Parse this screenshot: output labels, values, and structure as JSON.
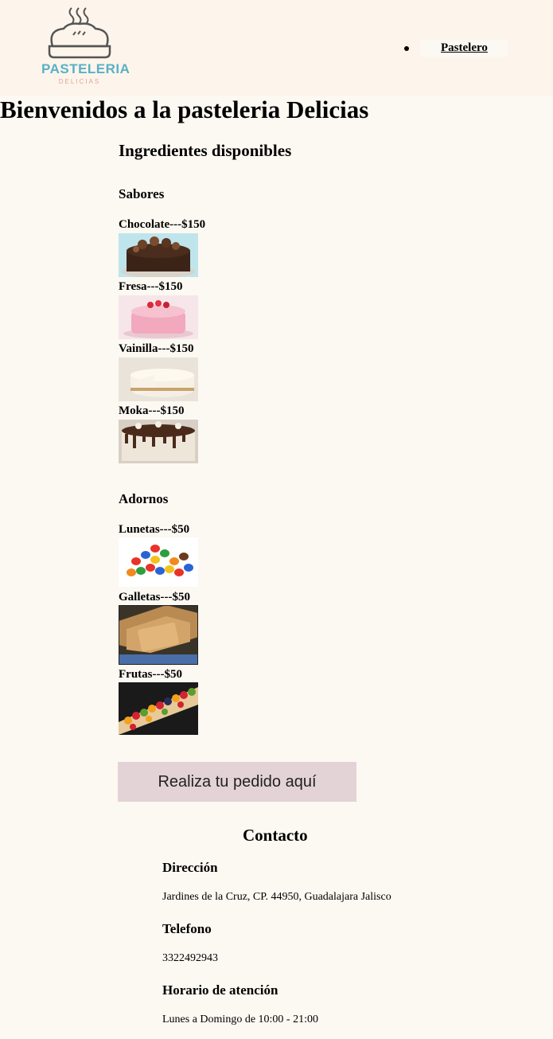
{
  "header": {
    "logo": {
      "name": "PASTELERIA",
      "sub": "DELICIAS"
    },
    "nav": [
      {
        "label": "Pastelero"
      }
    ]
  },
  "page_title": "Bienvenidos a la pasteleria Delicias",
  "ingredients": {
    "title": "Ingredientes disponibles",
    "sabores_title": "Sabores",
    "sabores": [
      {
        "label": "Chocolate---$150",
        "image": "chocolate-cake"
      },
      {
        "label": "Fresa---$150",
        "image": "strawberry-cake"
      },
      {
        "label": "Vainilla---$150",
        "image": "vanilla-cheesecake"
      },
      {
        "label": "Moka---$150",
        "image": "moka-cake"
      }
    ],
    "adornos_title": "Adornos",
    "adornos": [
      {
        "label": "Lunetas---$50",
        "image": "candy-lunetas"
      },
      {
        "label": "Galletas---$50",
        "image": "cookies"
      },
      {
        "label": "Frutas---$50",
        "image": "fruit-tart"
      }
    ]
  },
  "order_button": "Realiza tu pedido aquí",
  "contact": {
    "title": "Contacto",
    "address_title": "Dirección",
    "address": "Jardines de la Cruz, CP. 44950, Guadalajara Jalisco",
    "phone_title": "Telefono",
    "phone": "3322492943",
    "hours_title": "Horario de atención",
    "hours": "Lunes a Domingo de 10:00 - 21:00"
  }
}
